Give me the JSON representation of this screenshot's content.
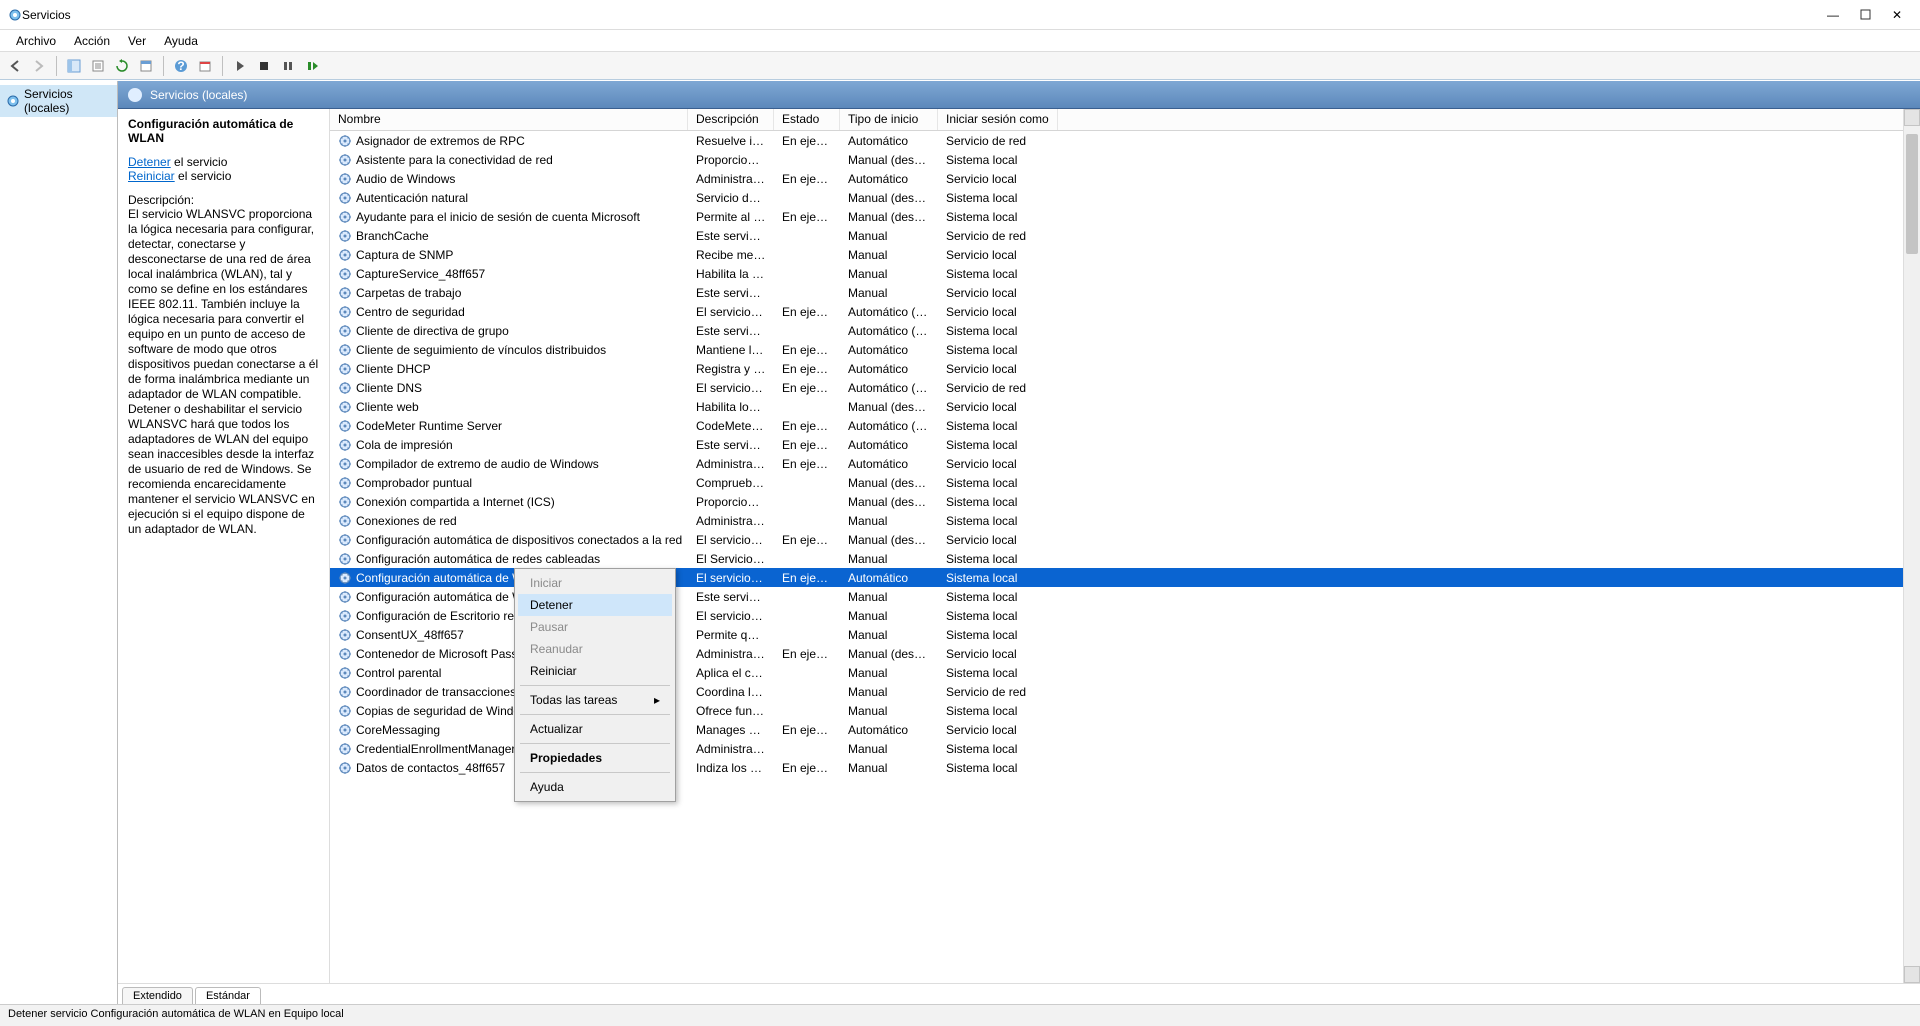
{
  "window": {
    "title": "Servicios",
    "minimize": "—",
    "maximize": "▢",
    "close": "✕"
  },
  "menubar": [
    "Archivo",
    "Acción",
    "Ver",
    "Ayuda"
  ],
  "tree": {
    "root_label": "Servicios (locales)"
  },
  "header_band": "Servicios (locales)",
  "info": {
    "title": "Configuración automática de WLAN",
    "stop_label": "Detener",
    "stop_suffix": " el servicio",
    "restart_label": "Reiniciar",
    "restart_suffix": " el servicio",
    "desc_heading": "Descripción:",
    "desc_body": "El servicio WLANSVC proporciona la lógica necesaria para configurar, detectar, conectarse y desconectarse de una red de área local inalámbrica (WLAN), tal y como se define en los estándares IEEE 802.11. También incluye la lógica necesaria para convertir el equipo en un punto de acceso de software de modo que otros dispositivos puedan conectarse a él de forma inalámbrica mediante un adaptador de WLAN compatible. Detener o deshabilitar el servicio WLANSVC hará que todos los adaptadores de WLAN del equipo sean inaccesibles desde la interfaz de usuario de red de Windows. Se recomienda encarecidamente mantener el servicio WLANSVC en ejecución si el equipo dispone de un adaptador de WLAN."
  },
  "columns": {
    "name": "Nombre",
    "desc": "Descripción",
    "state": "Estado",
    "startup": "Tipo de inicio",
    "logon": "Iniciar sesión como"
  },
  "services": [
    {
      "name": "Asignador de extremos de RPC",
      "desc": "Resuelve ide...",
      "state": "En ejecu...",
      "startup": "Automático",
      "logon": "Servicio de red"
    },
    {
      "name": "Asistente para la conectividad de red",
      "desc": "Proporciona ...",
      "state": "",
      "startup": "Manual (desen...",
      "logon": "Sistema local"
    },
    {
      "name": "Audio de Windows",
      "desc": "Administra e...",
      "state": "En ejecu...",
      "startup": "Automático",
      "logon": "Servicio local"
    },
    {
      "name": "Autenticación natural",
      "desc": "Servicio de a...",
      "state": "",
      "startup": "Manual (desen...",
      "logon": "Sistema local"
    },
    {
      "name": "Ayudante para el inicio de sesión de cuenta Microsoft",
      "desc": "Permite al us...",
      "state": "En ejecu...",
      "startup": "Manual (desen...",
      "logon": "Sistema local"
    },
    {
      "name": "BranchCache",
      "desc": "Este servicio ...",
      "state": "",
      "startup": "Manual",
      "logon": "Servicio de red"
    },
    {
      "name": "Captura de SNMP",
      "desc": "Recibe mens...",
      "state": "",
      "startup": "Manual",
      "logon": "Servicio local"
    },
    {
      "name": "CaptureService_48ff657",
      "desc": "Habilita la fu...",
      "state": "",
      "startup": "Manual",
      "logon": "Sistema local"
    },
    {
      "name": "Carpetas de trabajo",
      "desc": "Este servicio ...",
      "state": "",
      "startup": "Manual",
      "logon": "Servicio local"
    },
    {
      "name": "Centro de seguridad",
      "desc": "El servicio W...",
      "state": "En ejecu...",
      "startup": "Automático (in...",
      "logon": "Servicio local"
    },
    {
      "name": "Cliente de directiva de grupo",
      "desc": "Este servicio ...",
      "state": "",
      "startup": "Automático (d...",
      "logon": "Sistema local"
    },
    {
      "name": "Cliente de seguimiento de vínculos distribuidos",
      "desc": "Mantiene lo...",
      "state": "En ejecu...",
      "startup": "Automático",
      "logon": "Sistema local"
    },
    {
      "name": "Cliente DHCP",
      "desc": "Registra y ac...",
      "state": "En ejecu...",
      "startup": "Automático",
      "logon": "Servicio local"
    },
    {
      "name": "Cliente DNS",
      "desc": "El servicio Cli...",
      "state": "En ejecu...",
      "startup": "Automático (d...",
      "logon": "Servicio de red"
    },
    {
      "name": "Cliente web",
      "desc": "Habilita los ...",
      "state": "",
      "startup": "Manual (desen...",
      "logon": "Servicio local"
    },
    {
      "name": "CodeMeter Runtime Server",
      "desc": "CodeMeter  ...",
      "state": "En ejecu...",
      "startup": "Automático (in...",
      "logon": "Sistema local"
    },
    {
      "name": "Cola de impresión",
      "desc": "Este servicio ...",
      "state": "En ejecu...",
      "startup": "Automático",
      "logon": "Sistema local"
    },
    {
      "name": "Compilador de extremo de audio de Windows",
      "desc": "Administra l...",
      "state": "En ejecu...",
      "startup": "Automático",
      "logon": "Servicio local"
    },
    {
      "name": "Comprobador puntual",
      "desc": "Comprueba ...",
      "state": "",
      "startup": "Manual (desen...",
      "logon": "Sistema local"
    },
    {
      "name": "Conexión compartida a Internet (ICS)",
      "desc": "Proporciona ...",
      "state": "",
      "startup": "Manual (desen...",
      "logon": "Sistema local"
    },
    {
      "name": "Conexiones de red",
      "desc": "Administra o...",
      "state": "",
      "startup": "Manual",
      "logon": "Sistema local"
    },
    {
      "name": "Configuración automática de dispositivos conectados a la red",
      "desc": "El servicio C...",
      "state": "En ejecu...",
      "startup": "Manual (desen...",
      "logon": "Servicio local"
    },
    {
      "name": "Configuración automática de redes cableadas",
      "desc": "El Servicio d...",
      "state": "",
      "startup": "Manual",
      "logon": "Sistema local"
    },
    {
      "name": "Configuración automática de W",
      "desc": "El servicio W...",
      "state": "En ejecu...",
      "startup": "Automático",
      "logon": "Sistema local",
      "selected": true
    },
    {
      "name": "Configuración automática de W",
      "desc": "Este servicio ...",
      "state": "",
      "startup": "Manual",
      "logon": "Sistema local"
    },
    {
      "name": "Configuración de Escritorio rem",
      "desc": "El servicio C...",
      "state": "",
      "startup": "Manual",
      "logon": "Sistema local"
    },
    {
      "name": "ConsentUX_48ff657",
      "desc": "Permite que ...",
      "state": "",
      "startup": "Manual",
      "logon": "Sistema local"
    },
    {
      "name": "Contenedor de Microsoft Passp",
      "desc": "Administra cl...",
      "state": "En ejecu...",
      "startup": "Manual (desen...",
      "logon": "Servicio local"
    },
    {
      "name": "Control parental",
      "desc": "Aplica el con...",
      "state": "",
      "startup": "Manual",
      "logon": "Sistema local"
    },
    {
      "name": "Coordinador de transacciones c",
      "desc": "Coordina las...",
      "state": "",
      "startup": "Manual",
      "logon": "Servicio de red"
    },
    {
      "name": "Copias de seguridad de Window",
      "desc": "Ofrece funci...",
      "state": "",
      "startup": "Manual",
      "logon": "Sistema local"
    },
    {
      "name": "CoreMessaging",
      "desc": "Manages co...",
      "state": "En ejecu...",
      "startup": "Automático",
      "logon": "Servicio local"
    },
    {
      "name": "CredentialEnrollmentManagerU",
      "desc": "Administrad...",
      "state": "",
      "startup": "Manual",
      "logon": "Sistema local"
    },
    {
      "name": "Datos de contactos_48ff657",
      "desc": "Indiza los da...",
      "state": "En ejecu...",
      "startup": "Manual",
      "logon": "Sistema local"
    }
  ],
  "context_menu": {
    "iniciar": "Iniciar",
    "detener": "Detener",
    "pausar": "Pausar",
    "reanudar": "Reanudar",
    "reiniciar": "Reiniciar",
    "todas": "Todas las tareas",
    "actualizar": "Actualizar",
    "propiedades": "Propiedades",
    "ayuda": "Ayuda"
  },
  "tabs": {
    "extendido": "Extendido",
    "estandar": "Estándar"
  },
  "statusbar": "Detener servicio Configuración automática de WLAN en Equipo local"
}
